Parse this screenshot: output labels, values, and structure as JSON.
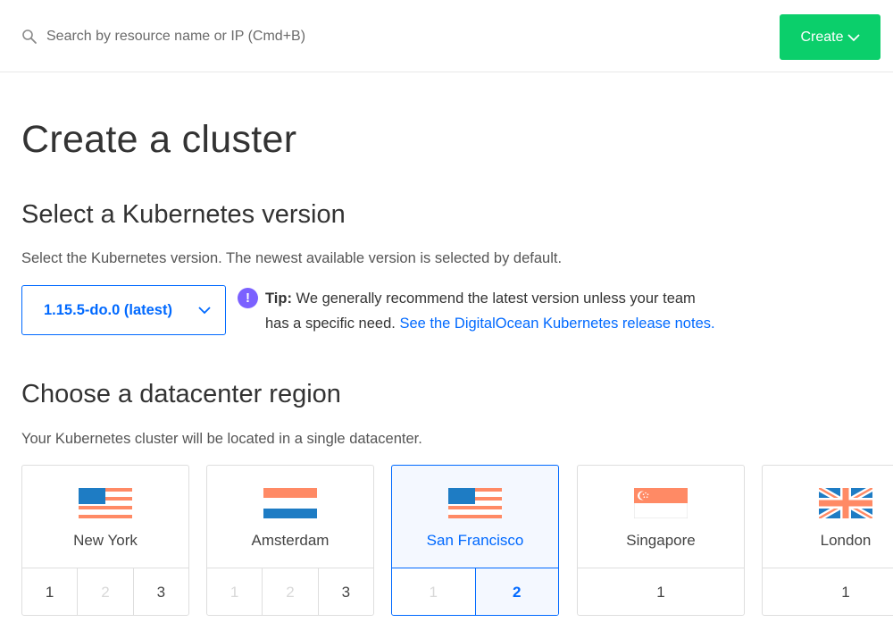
{
  "search": {
    "placeholder": "Search by resource name or IP (Cmd+B)"
  },
  "header": {
    "create_label": "Create"
  },
  "page": {
    "title": "Create a cluster"
  },
  "kubernetes": {
    "title": "Select a Kubernetes version",
    "description": "Select the Kubernetes version. The newest available version is selected by default.",
    "selected_version": "1.15.5-do.0 (latest)",
    "tip_label": "Tip:",
    "tip_text_1": "We generally recommend the latest version unless your team",
    "tip_text_2": "has a specific need.",
    "tip_link": "See the DigitalOcean Kubernetes release notes."
  },
  "datacenter": {
    "title": "Choose a datacenter region",
    "description": "Your Kubernetes cluster will be located in a single datacenter.",
    "regions": [
      {
        "name": "New York",
        "flag": "us-flag",
        "dcs": [
          "1",
          "2",
          "3"
        ]
      },
      {
        "name": "Amsterdam",
        "flag": "nl-flag",
        "dcs": [
          "1",
          "2",
          "3"
        ]
      },
      {
        "name": "San Francisco",
        "flag": "us-flag",
        "dcs": [
          "1",
          "2"
        ],
        "selected": true,
        "active_dc": "2"
      },
      {
        "name": "Singapore",
        "flag": "sg-flag",
        "dcs": [
          "1"
        ]
      },
      {
        "name": "London",
        "flag": "uk-flag",
        "dcs": [
          "1"
        ]
      }
    ]
  },
  "colors": {
    "accent": "#0069ff",
    "create_button": "#0bcf6b",
    "tip_icon": "#7b61ff",
    "flag_red": "#ff8a65",
    "flag_blue": "#1e7cc4"
  }
}
